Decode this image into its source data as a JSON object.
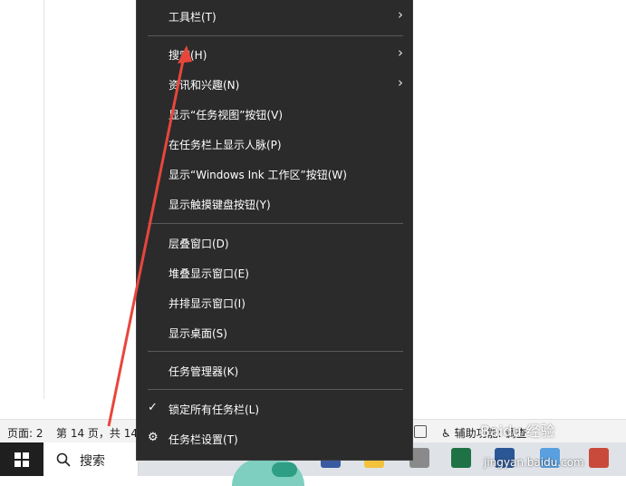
{
  "menu": {
    "toolbar": "工具栏(T)",
    "search": "搜索(H)",
    "news": "资讯和兴趣(N)",
    "task_view": "显示“任务视图”按钮(V)",
    "people": "在任务栏上显示人脉(P)",
    "ink": "显示“Windows Ink 工作区”按钮(W)",
    "touch_keyboard": "显示触摸键盘按钮(Y)",
    "cascade": "层叠窗口(D)",
    "stack": "堆叠显示窗口(E)",
    "side_by_side": "并排显示窗口(I)",
    "desktop": "显示桌面(S)",
    "task_manager": "任务管理器(K)",
    "lock": "锁定所有任务栏(L)",
    "settings": "任务栏设置(T)",
    "submenu_arrow": "›",
    "check": "✓",
    "gear": "⚙"
  },
  "statusbar": {
    "page": "页面: 2",
    "pages": "第 14 页，共 14",
    "accessibility": "辅助功能: 调查"
  },
  "taskbar": {
    "search_label": "搜索"
  },
  "watermark": {
    "brand": "Baidu 经验",
    "url": "jingyan.baidu.com"
  },
  "colors": {
    "menu_bg": "#2b2b2b",
    "annotation": "#e8463c"
  }
}
